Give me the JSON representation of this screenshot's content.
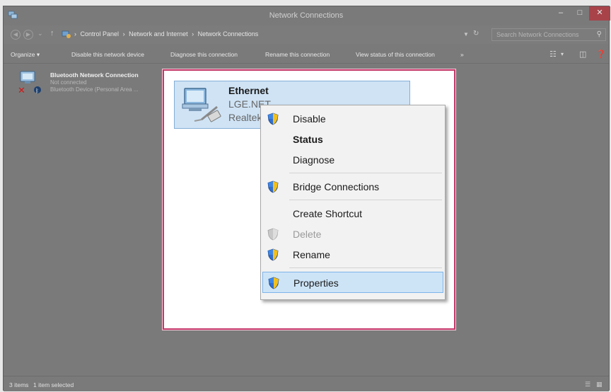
{
  "window": {
    "title": "Network Connections",
    "controls": {
      "minimize": "–",
      "maximize": "□",
      "close": "✕"
    }
  },
  "address": {
    "crumbs": [
      "Control Panel",
      "Network and Internet",
      "Network Connections"
    ],
    "separator": "›",
    "search_placeholder": "Search Network Connections"
  },
  "toolbar": {
    "organize": "Organize ▾",
    "disable": "Disable this network device",
    "diagnose": "Diagnose this connection",
    "rename": "Rename this connection",
    "view_status": "View status of this connection",
    "more": "»"
  },
  "connections": {
    "bluetooth": {
      "name": "Bluetooth Network Connection",
      "status": "Not connected",
      "device": "Bluetooth Device (Personal Area ..."
    },
    "ethernet": {
      "name": "Ethernet",
      "network": "LGE.NET",
      "adapter": "Realtek PCIe"
    }
  },
  "context_menu": {
    "items": [
      {
        "label": "Disable",
        "shield": true
      },
      {
        "label": "Status",
        "bold": true
      },
      {
        "label": "Diagnose"
      },
      {
        "label": "Bridge Connections",
        "shield": true
      },
      {
        "label": "Create Shortcut"
      },
      {
        "label": "Delete",
        "shield": true,
        "disabled": true
      },
      {
        "label": "Rename",
        "shield": true
      },
      {
        "label": "Properties",
        "shield": true,
        "selected": true
      }
    ]
  },
  "statusbar": {
    "items_count": "3 items",
    "selection": "1 item selected"
  },
  "colors": {
    "window_bg": "#7a7a7a",
    "highlight_border": "#c4396a",
    "selected_item_bg": "#cfe3f5",
    "menu_bg": "#f2f2f2",
    "close_button": "#a8434a"
  }
}
